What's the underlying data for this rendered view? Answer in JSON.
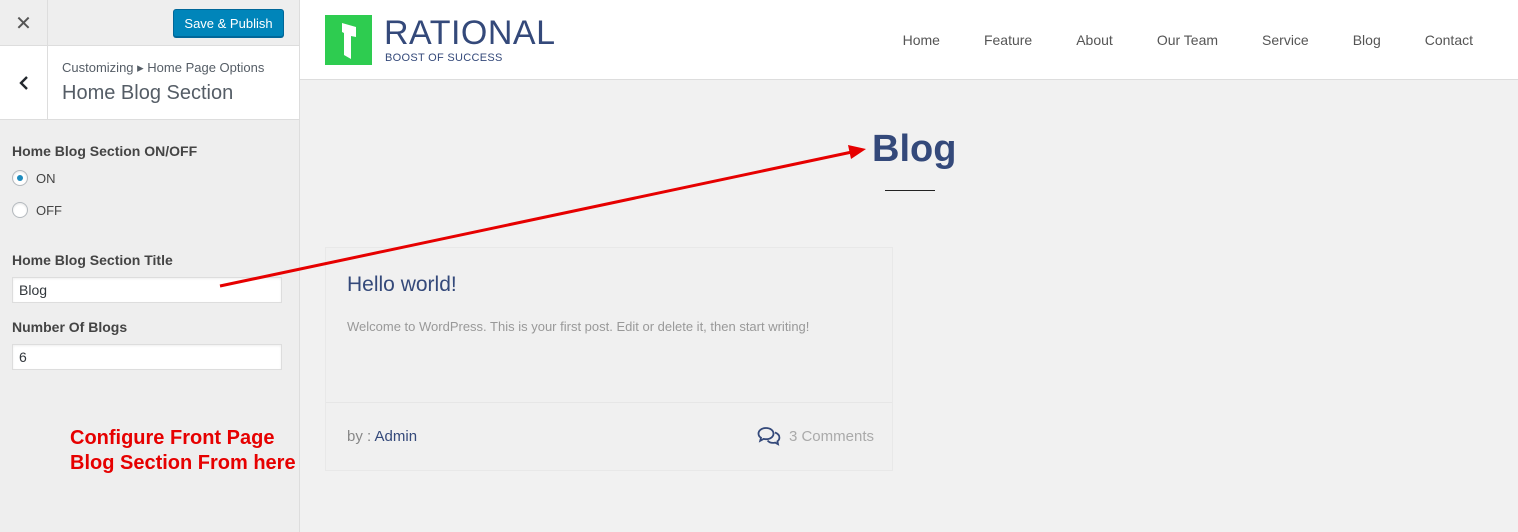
{
  "customizer": {
    "close_icon": "close-icon",
    "publish_label": "Save & Publish",
    "breadcrumb": "Customizing ▸ Home Page Options",
    "section_title": "Home Blog Section",
    "back_icon": "chevron-left-icon",
    "controls": {
      "toggle_label": "Home Blog Section ON/OFF",
      "options": [
        {
          "label": "ON",
          "selected": true
        },
        {
          "label": "OFF",
          "selected": false
        }
      ],
      "title_label": "Home Blog Section Title",
      "title_value": "Blog",
      "count_label": "Number Of Blogs",
      "count_value": "6"
    },
    "annotation": [
      "Configure Front Page",
      "Blog Section From here"
    ]
  },
  "site": {
    "logo": {
      "name": "RATIONAL",
      "tagline": "BOOST OF SUCCESS",
      "color": "#2ecc50"
    },
    "nav": [
      "Home",
      "Feature",
      "About",
      "Our Team",
      "Service",
      "Blog",
      "Contact"
    ],
    "blog_heading": "Blog",
    "post": {
      "title": "Hello world!",
      "excerpt": "Welcome to WordPress. This is your first post. Edit or delete it, then start writing!",
      "by_prefix": "by : ",
      "author": "Admin",
      "comments": "3 Comments",
      "comments_icon": "comments-icon"
    }
  },
  "colors": {
    "accent": "#0085ba",
    "brand": "#34497a",
    "annotation": "#e60000"
  }
}
